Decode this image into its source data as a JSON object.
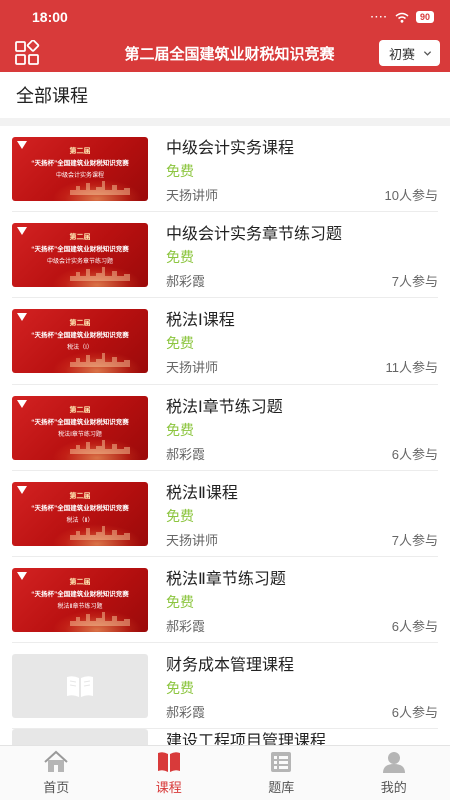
{
  "status": {
    "time": "18:00",
    "signal": "····",
    "battery": "90"
  },
  "header": {
    "title": "第二届全国建筑业财税知识竞赛",
    "round_select": "初赛",
    "accent": "#d83a3a"
  },
  "section": {
    "title": "全部课程"
  },
  "courses": [
    {
      "title": "中级会计实务课程",
      "price": "免费",
      "teacher": "天扬讲师",
      "count": "10人参与",
      "thumb": {
        "t1": "第二届",
        "t2": "“天扬杯”全国建筑业财税知识竞赛",
        "t3": "中级会计实务课程"
      }
    },
    {
      "title": "中级会计实务章节练习题",
      "price": "免费",
      "teacher": "郝彩霞",
      "count": "7人参与",
      "thumb": {
        "t1": "第二届",
        "t2": "“天扬杯”全国建筑业财税知识竞赛",
        "t3": "中级会计实务章节练习题"
      }
    },
    {
      "title": "税法Ⅰ课程",
      "price": "免费",
      "teacher": "天扬讲师",
      "count": "11人参与",
      "thumb": {
        "t1": "第二届",
        "t2": "“天扬杯”全国建筑业财税知识竞赛",
        "t3": "税法（Ⅰ）"
      }
    },
    {
      "title": "税法Ⅰ章节练习题",
      "price": "免费",
      "teacher": "郝彩霞",
      "count": "6人参与",
      "thumb": {
        "t1": "第二届",
        "t2": "“天扬杯”全国建筑业财税知识竞赛",
        "t3": "税法Ⅰ章节练习题"
      }
    },
    {
      "title": "税法Ⅱ课程",
      "price": "免费",
      "teacher": "天扬讲师",
      "count": "7人参与",
      "thumb": {
        "t1": "第二届",
        "t2": "“天扬杯”全国建筑业财税知识竞赛",
        "t3": "税法（Ⅱ）"
      }
    },
    {
      "title": "税法Ⅱ章节练习题",
      "price": "免费",
      "teacher": "郝彩霞",
      "count": "6人参与",
      "thumb": {
        "t1": "第二届",
        "t2": "“天扬杯”全国建筑业财税知识竞赛",
        "t3": "税法Ⅱ章节练习题"
      }
    },
    {
      "title": "财务成本管理课程",
      "price": "免费",
      "teacher": "郝彩霞",
      "count": "6人参与",
      "thumb": null
    }
  ],
  "partial_course": {
    "title": "建设工程项目管理课程"
  },
  "tabs": [
    {
      "label": "首页",
      "icon": "home-icon"
    },
    {
      "label": "课程",
      "icon": "book-icon",
      "active": true
    },
    {
      "label": "题库",
      "icon": "question-bank-icon"
    },
    {
      "label": "我的",
      "icon": "profile-icon"
    }
  ],
  "colors": {
    "free": "#8cc53f",
    "tab_active": "#d83a3a"
  }
}
